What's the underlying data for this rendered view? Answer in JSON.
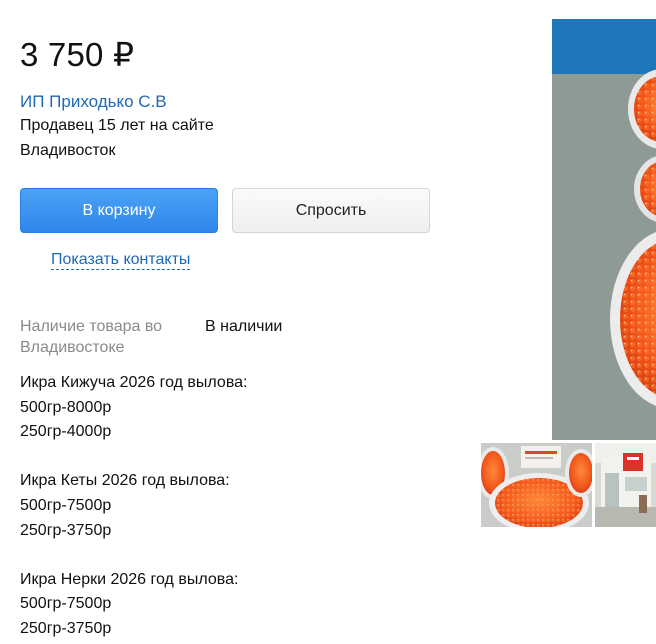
{
  "product": {
    "price": "3 750 ₽"
  },
  "seller": {
    "name": "ИП Приходько С.В",
    "since": "Продавец 15 лет на сайте",
    "city": "Владивосток"
  },
  "actions": {
    "cart_label": "В корзину",
    "ask_label": "Спросить",
    "contacts_label": "Показать контакты"
  },
  "availability": {
    "label": "Наличие товара во Владивостоке",
    "value": "В наличии"
  },
  "description": {
    "text": "Икра Кижуча 2026 год вылова:\n500гр-8000р\n250гр-4000р\n\nИкра Кеты 2026 год вылова:\n500гр-7500р\n250гр-3750р\n\nИкра Нерки 2026 год вылова:\n500гр-7500р\n250гр-3750р"
  },
  "gallery": {
    "main_photo_icon": "caviar-jars-photo",
    "thumbnails": [
      "caviar-jar-thumbnail",
      "storefront-thumbnail"
    ]
  },
  "colors": {
    "accent_blue": "#2f86ea",
    "link_blue": "#1f68b6",
    "caviar_orange": "#f2551c"
  }
}
